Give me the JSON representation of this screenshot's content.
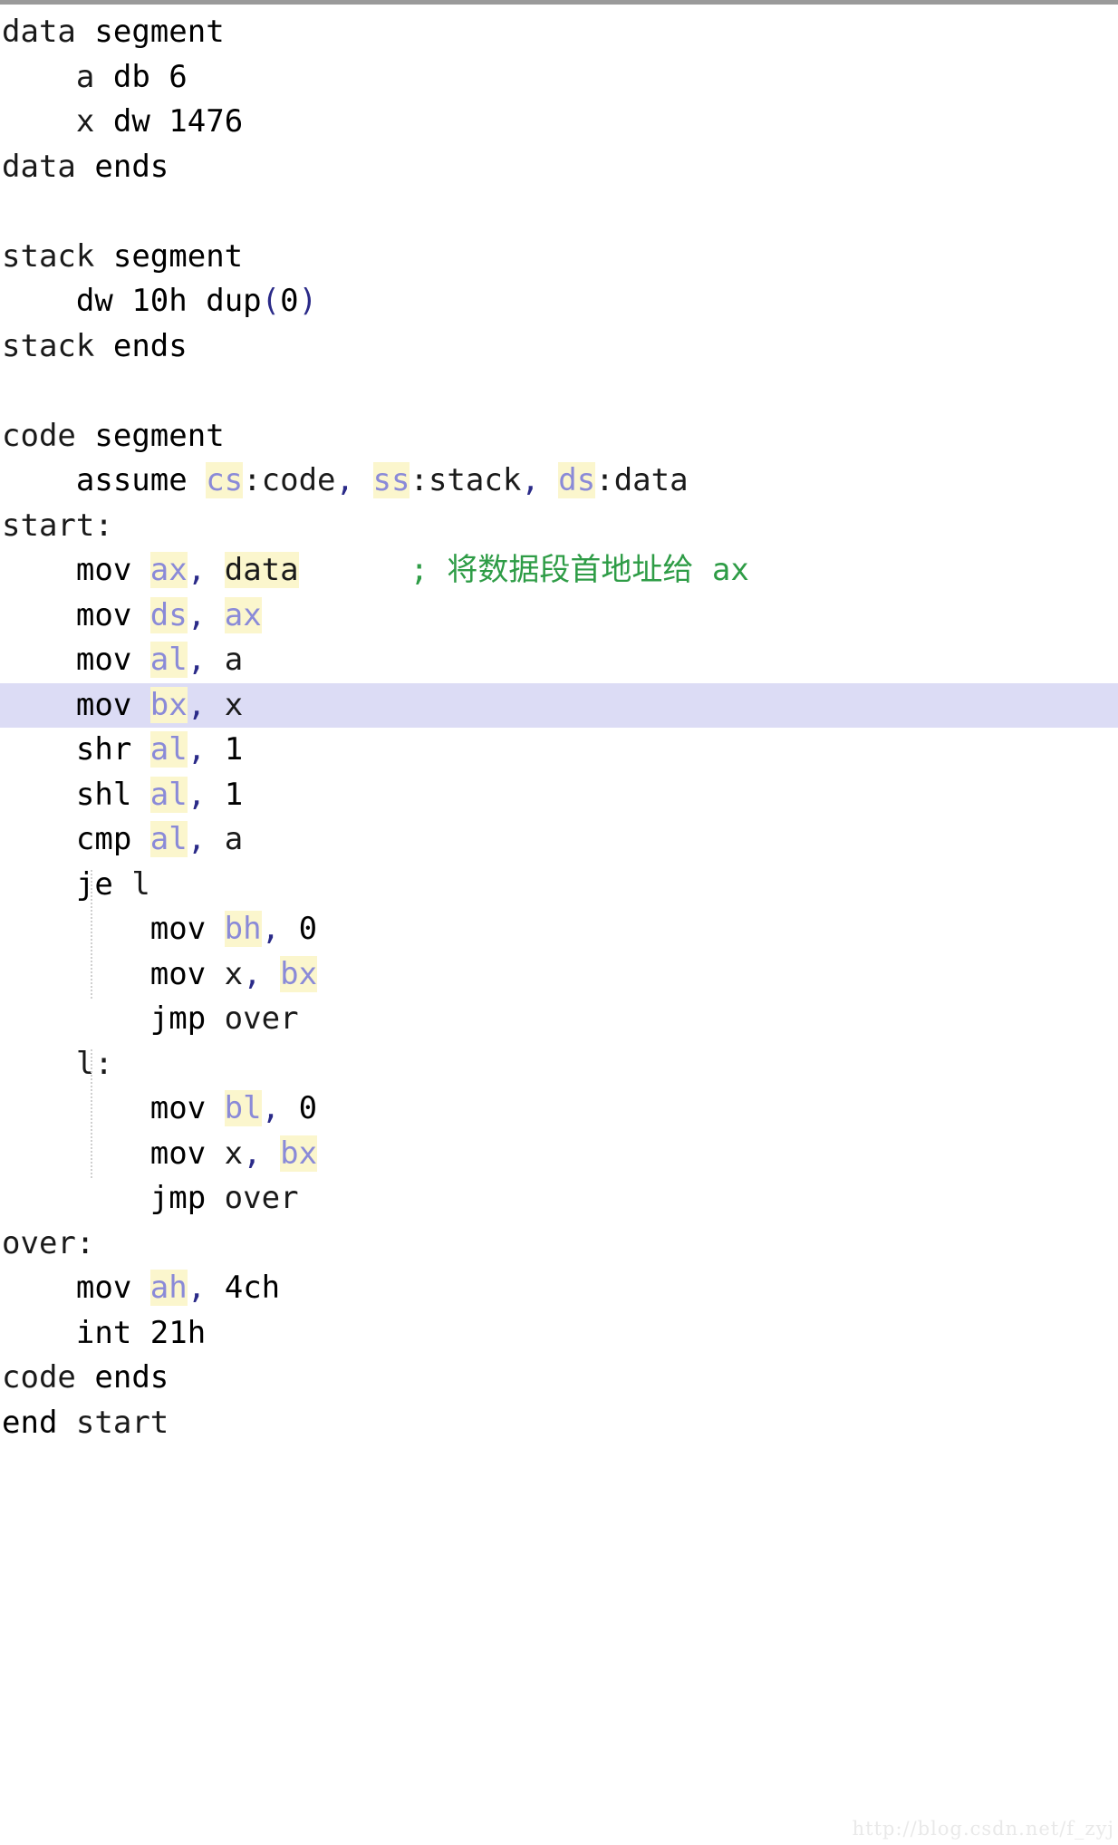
{
  "editor": {
    "language": "assembly",
    "background_color": "#ffffff",
    "current_line_highlight_color": "#dcdcf5",
    "occurrence_highlight_color": "#fbf6cd",
    "top_border_color": "#9a9a9a",
    "colors": {
      "directive": "#3a9bf5",
      "keyword": "#2222c8",
      "number": "#f79c38",
      "register": "#8a8ad8",
      "comment": "#2e9c46",
      "plain": "#1a1a1a",
      "punctuation": "#2a2a88"
    }
  },
  "watermark": {
    "text": "http://blog.csdn.net/f_zyj"
  },
  "code": {
    "current_line_index": 15,
    "lines": [
      {
        "indent": "",
        "tokens": [
          {
            "t": "data",
            "c": "plain"
          },
          {
            "t": " ",
            "c": "plain"
          },
          {
            "t": "segment",
            "c": "directive"
          }
        ]
      },
      {
        "indent": "    ",
        "tokens": [
          {
            "t": "a",
            "c": "plain"
          },
          {
            "t": " ",
            "c": "plain"
          },
          {
            "t": "db",
            "c": "directive"
          },
          {
            "t": " ",
            "c": "plain"
          },
          {
            "t": "6",
            "c": "number"
          }
        ]
      },
      {
        "indent": "    ",
        "tokens": [
          {
            "t": "x",
            "c": "plain"
          },
          {
            "t": " ",
            "c": "plain"
          },
          {
            "t": "dw",
            "c": "directive"
          },
          {
            "t": " ",
            "c": "plain"
          },
          {
            "t": "1476",
            "c": "number"
          }
        ]
      },
      {
        "indent": "",
        "tokens": [
          {
            "t": "data",
            "c": "plain"
          },
          {
            "t": " ",
            "c": "plain"
          },
          {
            "t": "ends",
            "c": "directive"
          }
        ]
      },
      {
        "indent": "",
        "tokens": []
      },
      {
        "indent": "",
        "tokens": [
          {
            "t": "stack",
            "c": "plain"
          },
          {
            "t": " ",
            "c": "plain"
          },
          {
            "t": "segment",
            "c": "directive"
          }
        ]
      },
      {
        "indent": "    ",
        "tokens": [
          {
            "t": "dw",
            "c": "directive"
          },
          {
            "t": " ",
            "c": "plain"
          },
          {
            "t": "10h",
            "c": "number"
          },
          {
            "t": " ",
            "c": "plain"
          },
          {
            "t": "dup",
            "c": "directive"
          },
          {
            "t": "(",
            "c": "punct"
          },
          {
            "t": "0",
            "c": "number"
          },
          {
            "t": ")",
            "c": "punct"
          }
        ]
      },
      {
        "indent": "",
        "tokens": [
          {
            "t": "stack",
            "c": "plain"
          },
          {
            "t": " ",
            "c": "plain"
          },
          {
            "t": "ends",
            "c": "directive"
          }
        ]
      },
      {
        "indent": "",
        "tokens": []
      },
      {
        "indent": "",
        "tokens": [
          {
            "t": "code",
            "c": "plain"
          },
          {
            "t": " ",
            "c": "plain"
          },
          {
            "t": "segment",
            "c": "directive"
          }
        ]
      },
      {
        "indent": "    ",
        "tokens": [
          {
            "t": "assume",
            "c": "directive"
          },
          {
            "t": " ",
            "c": "plain"
          },
          {
            "t": "cs",
            "c": "reg"
          },
          {
            "t": ":",
            "c": "plain"
          },
          {
            "t": "code",
            "c": "plain"
          },
          {
            "t": ",",
            "c": "punct"
          },
          {
            "t": " ",
            "c": "plain"
          },
          {
            "t": "ss",
            "c": "reg"
          },
          {
            "t": ":",
            "c": "plain"
          },
          {
            "t": "stack",
            "c": "plain"
          },
          {
            "t": ",",
            "c": "punct"
          },
          {
            "t": " ",
            "c": "plain"
          },
          {
            "t": "ds",
            "c": "reg"
          },
          {
            "t": ":",
            "c": "plain"
          },
          {
            "t": "data",
            "c": "plain"
          }
        ]
      },
      {
        "indent": "",
        "tokens": [
          {
            "t": "start:",
            "c": "plain"
          }
        ]
      },
      {
        "indent": "    ",
        "tokens": [
          {
            "t": "mov",
            "c": "keyword"
          },
          {
            "t": " ",
            "c": "plain"
          },
          {
            "t": "ax",
            "c": "reg"
          },
          {
            "t": ",",
            "c": "punct"
          },
          {
            "t": " ",
            "c": "plain"
          },
          {
            "t": "data",
            "c": "ident-hl"
          },
          {
            "t": "      ",
            "c": "plain"
          },
          {
            "t": "; 将数据段首地址给 ax",
            "c": "comment"
          }
        ]
      },
      {
        "indent": "    ",
        "tokens": [
          {
            "t": "mov",
            "c": "keyword"
          },
          {
            "t": " ",
            "c": "plain"
          },
          {
            "t": "ds",
            "c": "reg"
          },
          {
            "t": ",",
            "c": "punct"
          },
          {
            "t": " ",
            "c": "plain"
          },
          {
            "t": "ax",
            "c": "reg"
          }
        ]
      },
      {
        "indent": "    ",
        "tokens": [
          {
            "t": "mov",
            "c": "keyword"
          },
          {
            "t": " ",
            "c": "plain"
          },
          {
            "t": "al",
            "c": "reg"
          },
          {
            "t": ",",
            "c": "punct"
          },
          {
            "t": " ",
            "c": "plain"
          },
          {
            "t": "a",
            "c": "plain"
          }
        ]
      },
      {
        "indent": "    ",
        "tokens": [
          {
            "t": "mov",
            "c": "keyword"
          },
          {
            "t": " ",
            "c": "plain"
          },
          {
            "t": "bx",
            "c": "reg"
          },
          {
            "t": ",",
            "c": "punct"
          },
          {
            "t": " ",
            "c": "plain"
          },
          {
            "t": "x",
            "c": "plain"
          }
        ]
      },
      {
        "indent": "    ",
        "tokens": [
          {
            "t": "shr",
            "c": "keyword"
          },
          {
            "t": " ",
            "c": "plain"
          },
          {
            "t": "al",
            "c": "reg"
          },
          {
            "t": ",",
            "c": "punct"
          },
          {
            "t": " ",
            "c": "plain"
          },
          {
            "t": "1",
            "c": "number"
          }
        ]
      },
      {
        "indent": "    ",
        "tokens": [
          {
            "t": "shl",
            "c": "keyword"
          },
          {
            "t": " ",
            "c": "plain"
          },
          {
            "t": "al",
            "c": "reg"
          },
          {
            "t": ",",
            "c": "punct"
          },
          {
            "t": " ",
            "c": "plain"
          },
          {
            "t": "1",
            "c": "number"
          }
        ]
      },
      {
        "indent": "    ",
        "tokens": [
          {
            "t": "cmp",
            "c": "keyword"
          },
          {
            "t": " ",
            "c": "plain"
          },
          {
            "t": "al",
            "c": "reg"
          },
          {
            "t": ",",
            "c": "punct"
          },
          {
            "t": " ",
            "c": "plain"
          },
          {
            "t": "a",
            "c": "plain"
          }
        ]
      },
      {
        "indent": "    ",
        "tokens": [
          {
            "t": "je",
            "c": "keyword"
          },
          {
            "t": " ",
            "c": "plain"
          },
          {
            "t": "l",
            "c": "plain"
          }
        ]
      },
      {
        "indent": "        ",
        "tokens": [
          {
            "t": "mov",
            "c": "keyword"
          },
          {
            "t": " ",
            "c": "plain"
          },
          {
            "t": "bh",
            "c": "reg"
          },
          {
            "t": ",",
            "c": "punct"
          },
          {
            "t": " ",
            "c": "plain"
          },
          {
            "t": "0",
            "c": "number"
          }
        ]
      },
      {
        "indent": "        ",
        "tokens": [
          {
            "t": "mov",
            "c": "keyword"
          },
          {
            "t": " ",
            "c": "plain"
          },
          {
            "t": "x",
            "c": "plain"
          },
          {
            "t": ",",
            "c": "punct"
          },
          {
            "t": " ",
            "c": "plain"
          },
          {
            "t": "bx",
            "c": "reg"
          }
        ]
      },
      {
        "indent": "        ",
        "tokens": [
          {
            "t": "jmp",
            "c": "keyword"
          },
          {
            "t": " ",
            "c": "plain"
          },
          {
            "t": "over",
            "c": "plain"
          }
        ]
      },
      {
        "indent": "    ",
        "tokens": [
          {
            "t": "l:",
            "c": "plain"
          }
        ]
      },
      {
        "indent": "        ",
        "tokens": [
          {
            "t": "mov",
            "c": "keyword"
          },
          {
            "t": " ",
            "c": "plain"
          },
          {
            "t": "bl",
            "c": "reg"
          },
          {
            "t": ",",
            "c": "punct"
          },
          {
            "t": " ",
            "c": "plain"
          },
          {
            "t": "0",
            "c": "number"
          }
        ]
      },
      {
        "indent": "        ",
        "tokens": [
          {
            "t": "mov",
            "c": "keyword"
          },
          {
            "t": " ",
            "c": "plain"
          },
          {
            "t": "x",
            "c": "plain"
          },
          {
            "t": ",",
            "c": "punct"
          },
          {
            "t": " ",
            "c": "plain"
          },
          {
            "t": "bx",
            "c": "reg"
          }
        ]
      },
      {
        "indent": "        ",
        "tokens": [
          {
            "t": "jmp",
            "c": "keyword"
          },
          {
            "t": " ",
            "c": "plain"
          },
          {
            "t": "over",
            "c": "plain"
          }
        ]
      },
      {
        "indent": "",
        "tokens": [
          {
            "t": "over:",
            "c": "plain"
          }
        ]
      },
      {
        "indent": "    ",
        "tokens": [
          {
            "t": "mov",
            "c": "keyword"
          },
          {
            "t": " ",
            "c": "plain"
          },
          {
            "t": "ah",
            "c": "reg"
          },
          {
            "t": ",",
            "c": "punct"
          },
          {
            "t": " ",
            "c": "plain"
          },
          {
            "t": "4ch",
            "c": "number"
          }
        ]
      },
      {
        "indent": "    ",
        "tokens": [
          {
            "t": "int",
            "c": "keyword"
          },
          {
            "t": " ",
            "c": "plain"
          },
          {
            "t": "21h",
            "c": "number"
          }
        ]
      },
      {
        "indent": "",
        "tokens": [
          {
            "t": "code",
            "c": "plain"
          },
          {
            "t": " ",
            "c": "plain"
          },
          {
            "t": "ends",
            "c": "directive"
          }
        ]
      },
      {
        "indent": "",
        "tokens": [
          {
            "t": "end",
            "c": "directive"
          },
          {
            "t": " ",
            "c": "plain"
          },
          {
            "t": "start",
            "c": "plain"
          }
        ]
      }
    ],
    "indent_guides": [
      {
        "after_line": 19,
        "span_lines": 3
      },
      {
        "after_line": 23,
        "span_lines": 3
      }
    ]
  }
}
